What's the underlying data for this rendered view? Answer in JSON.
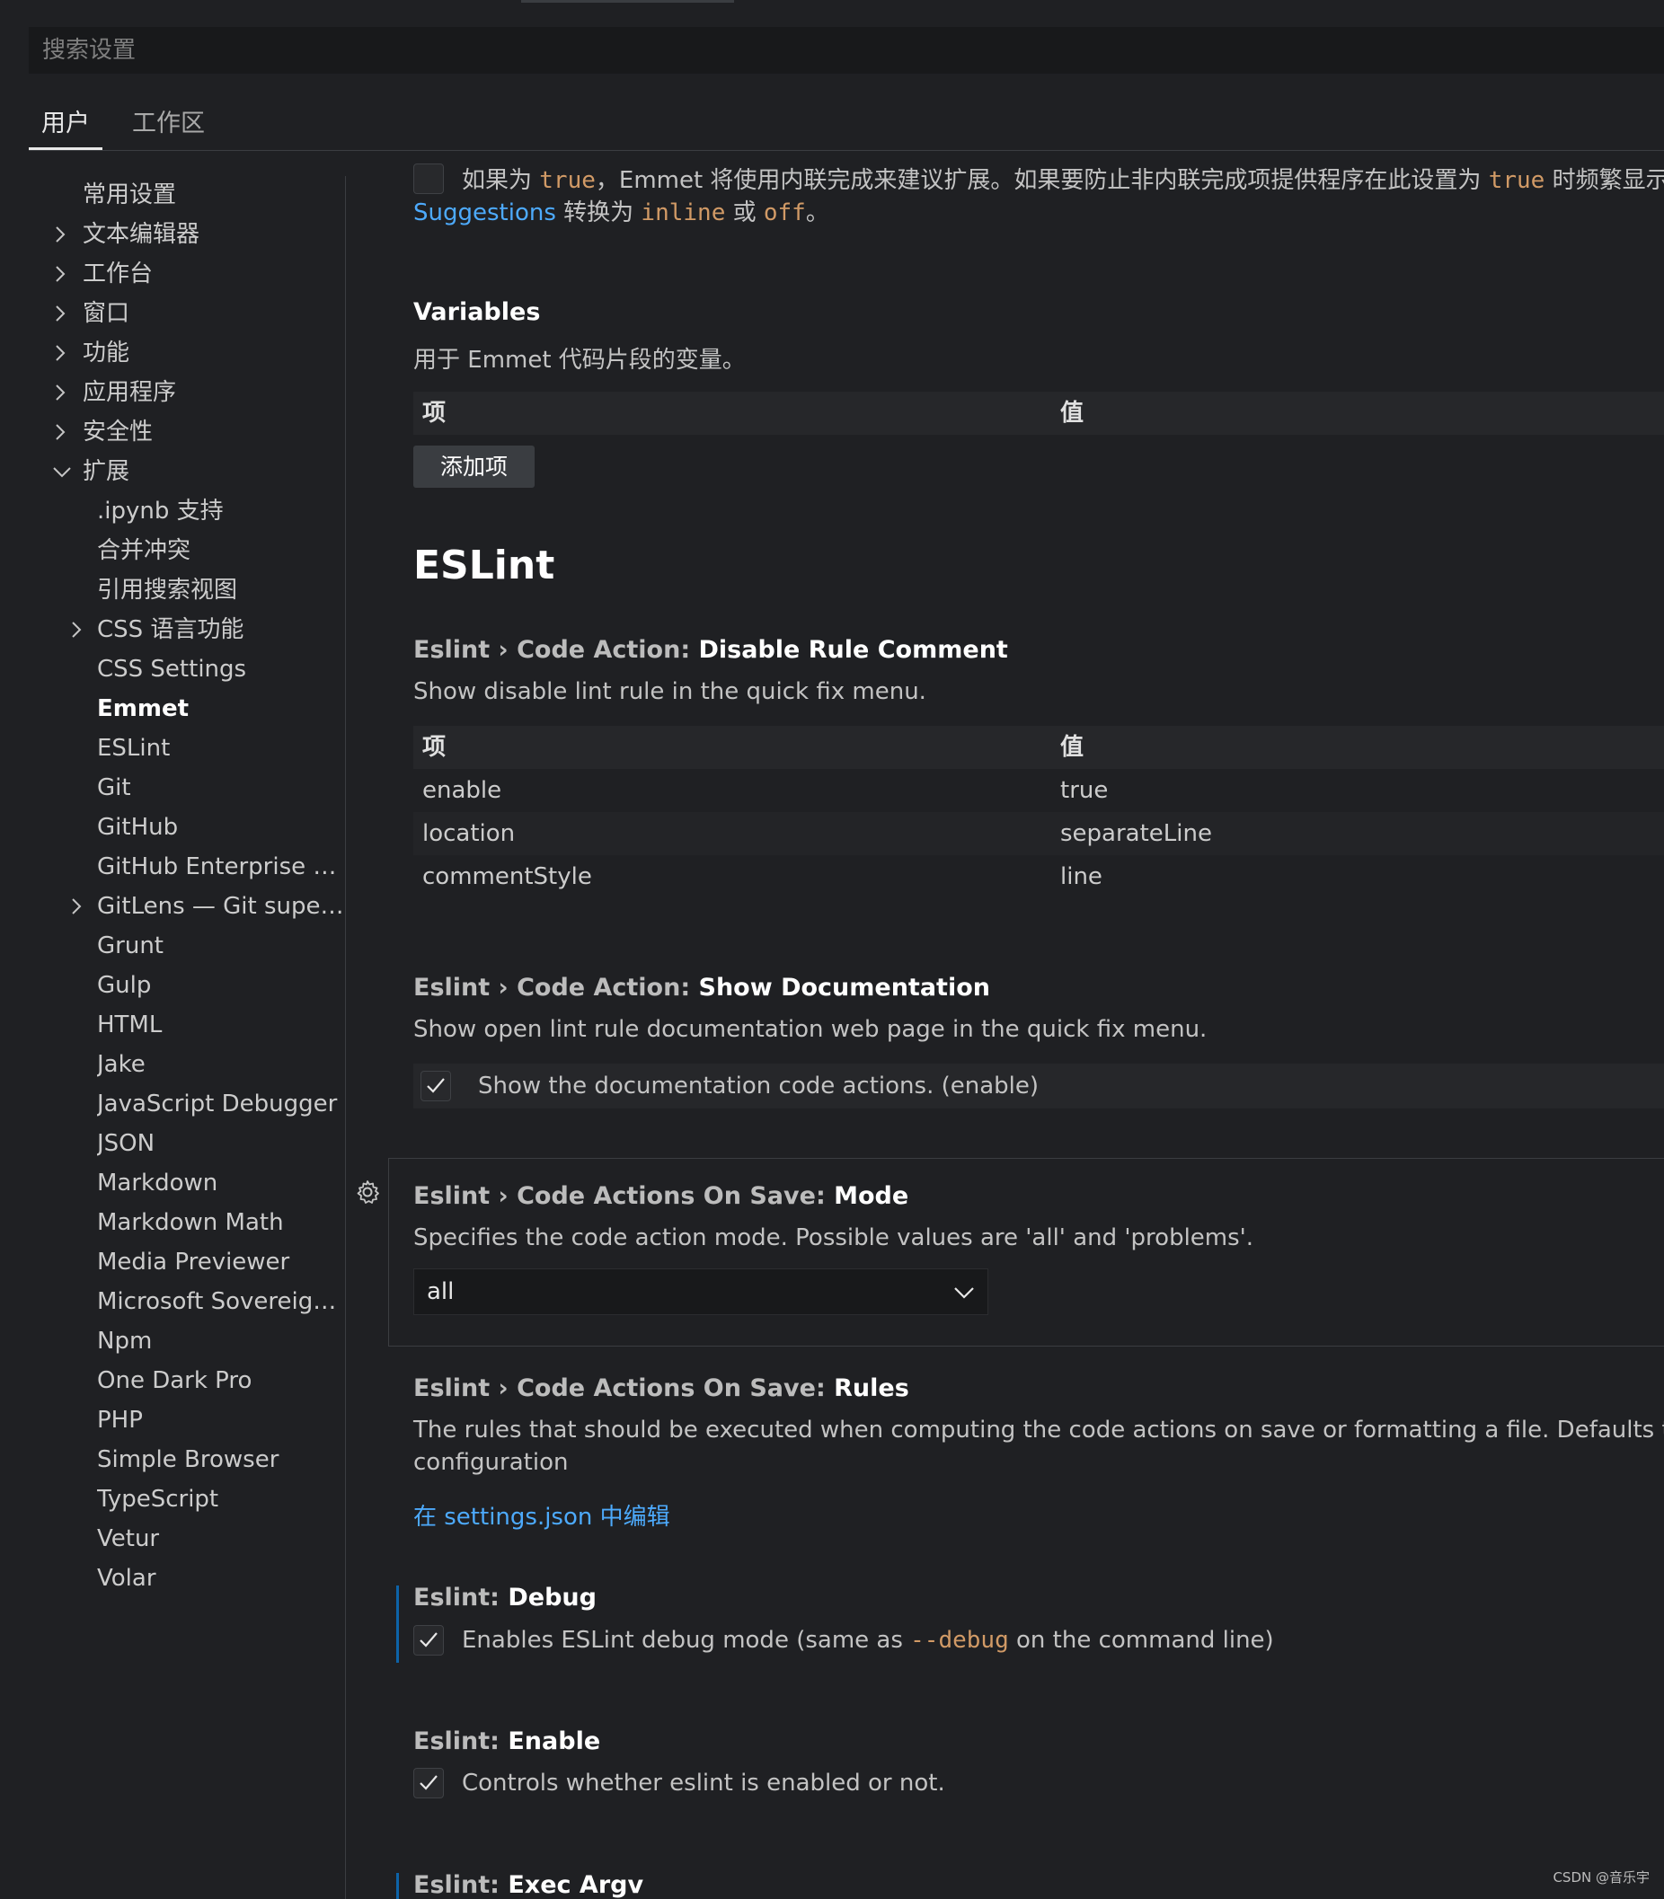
{
  "search": {
    "placeholder": "搜索设置"
  },
  "tabs": [
    {
      "label": "用户"
    },
    {
      "label": "工作区"
    }
  ],
  "tree": [
    {
      "label": "常用设置"
    },
    {
      "label": "文本编辑器"
    },
    {
      "label": "工作台"
    },
    {
      "label": "窗口"
    },
    {
      "label": "功能"
    },
    {
      "label": "应用程序"
    },
    {
      "label": "安全性"
    },
    {
      "label": "扩展"
    },
    {
      "label": ".ipynb 支持"
    },
    {
      "label": "合并冲突"
    },
    {
      "label": "引用搜索视图"
    },
    {
      "label": "CSS 语言功能"
    },
    {
      "label": "CSS Settings"
    },
    {
      "label": "Emmet"
    },
    {
      "label": "ESLint"
    },
    {
      "label": "Git"
    },
    {
      "label": "GitHub"
    },
    {
      "label": "GitHub Enterprise Se..."
    },
    {
      "label": "GitLens — Git superc..."
    },
    {
      "label": "Grunt"
    },
    {
      "label": "Gulp"
    },
    {
      "label": "HTML"
    },
    {
      "label": "Jake"
    },
    {
      "label": "JavaScript Debugger"
    },
    {
      "label": "JSON"
    },
    {
      "label": "Markdown"
    },
    {
      "label": "Markdown Math"
    },
    {
      "label": "Media Previewer"
    },
    {
      "label": "Microsoft Sovereign ..."
    },
    {
      "label": "Npm"
    },
    {
      "label": "One Dark Pro"
    },
    {
      "label": "PHP"
    },
    {
      "label": "Simple Browser"
    },
    {
      "label": "TypeScript"
    },
    {
      "label": "Vetur"
    },
    {
      "label": "Volar"
    }
  ],
  "main": {
    "partial": {
      "l1_a": "如果为 ",
      "l1_code1": "true",
      "l1_b": "，Emmet 将使用内联完成来建议扩展。如果要防止非内联完成项提供程序在此设置为 ",
      "l1_code2": "true",
      "l1_c": " 时频繁显示，",
      "l2_link": "Suggestions",
      "l2_a": " 转换为 ",
      "l2_code1": "inline",
      "l2_b": " 或 ",
      "l2_code2": "off",
      "l2_c": "。"
    },
    "variables": {
      "title": "Variables",
      "desc": "用于 Emmet 代码片段的变量。",
      "col_key": "项",
      "col_value": "值",
      "add_button": "添加项"
    },
    "eslint_heading": "ESLint",
    "disable_rule": {
      "category": "Eslint › Code Action: ",
      "name": "Disable Rule Comment",
      "desc": "Show disable lint rule in the quick fix menu.",
      "col_key": "项",
      "col_value": "值",
      "rows": [
        {
          "key": "enable",
          "value": "true"
        },
        {
          "key": "location",
          "value": "separateLine"
        },
        {
          "key": "commentStyle",
          "value": "line"
        }
      ]
    },
    "show_docs": {
      "category": "Eslint › Code Action: ",
      "name": "Show Documentation",
      "desc": "Show open lint rule documentation web page in the quick fix menu.",
      "checkbox_label": "Show the documentation code actions. (enable)",
      "checked": true
    },
    "mode": {
      "category": "Eslint › Code Actions On Save: ",
      "name": "Mode",
      "desc": "Specifies the code action mode. Possible values are 'all' and 'problems'.",
      "value": "all"
    },
    "rules": {
      "category": "Eslint › Code Actions On Save: ",
      "name": "Rules",
      "desc_line1": "The rules that should be executed when computing the code actions on save or formatting a file. Defaults to the rul",
      "desc_line2": "configuration",
      "edit_link": "在 settings.json 中编辑"
    },
    "debug": {
      "category": "Eslint: ",
      "name": "Debug",
      "desc_a": "Enables ESLint debug mode (same as ",
      "desc_code": "--debug",
      "desc_b": " on the command line)",
      "checked": true
    },
    "enable": {
      "category": "Eslint: ",
      "name": "Enable",
      "desc": "Controls whether eslint is enabled or not.",
      "checked": true
    },
    "exec_argv": {
      "category": "Eslint: ",
      "name": "Exec Argv"
    }
  },
  "watermark": "CSDN @音乐宇",
  "colors": {
    "background": "#1f2023",
    "link": "#4daafc",
    "code": "#ce9178",
    "modified_indicator": "#0d63a8"
  }
}
